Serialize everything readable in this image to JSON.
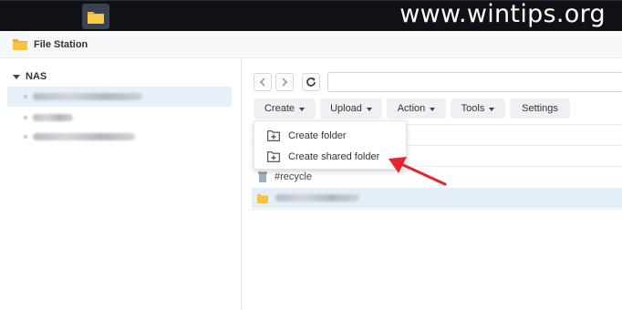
{
  "watermark": "www.wintips.org",
  "taskbar": {
    "items": [
      {
        "name": "main-menu",
        "icon": "grid-icon"
      },
      {
        "name": "file-station",
        "icon": "folder-icon"
      }
    ]
  },
  "app": {
    "title": "File Station",
    "icon": "folder-icon"
  },
  "sidebar": {
    "root_label": "NAS"
  },
  "toolbar": {
    "back_icon": "chevron-left-icon",
    "forward_icon": "chevron-right-icon",
    "refresh_icon": "refresh-icon",
    "address_value": "",
    "create_label": "Create",
    "upload_label": "Upload",
    "action_label": "Action",
    "tools_label": "Tools",
    "settings_label": "Settings"
  },
  "create_menu": {
    "items": [
      {
        "label": "Create folder",
        "icon": "folder-plus-icon"
      },
      {
        "label": "Create shared folder",
        "icon": "folder-plus-icon"
      }
    ]
  },
  "files": [
    {
      "name": "#recycle",
      "icon": "trash-icon"
    }
  ],
  "colors": {
    "taskbar": "#0f1116",
    "selection": "#e6f0fb",
    "folder": "#f5c242",
    "arrow": "#e3262b"
  }
}
